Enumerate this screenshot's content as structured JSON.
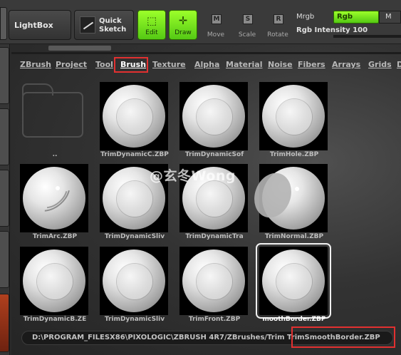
{
  "toolbar": {
    "lightbox_label": "LightBox",
    "quick_line1": "Quick",
    "quick_line2": "Sketch",
    "edit_label": "Edit",
    "draw_label": "Draw",
    "move_label": "Move",
    "move_key": "M",
    "scale_label": "Scale",
    "scale_key": "S",
    "rotate_label": "Rotate",
    "rotate_key": "R",
    "mrgb_label": "Mrgb",
    "rgb_label": "Rgb",
    "m_label": "M",
    "intensity_label": "Rgb  Intensity 100",
    "accent_color": "#7de81f"
  },
  "tabs": [
    "ZBrush",
    "Project",
    "Tool",
    "Brush",
    "Texture",
    "Alpha",
    "Material",
    "Noise",
    "Fibers",
    "Arrays",
    "Grids",
    "D"
  ],
  "active_tab": "Brush",
  "tiles": [
    {
      "label": "..",
      "kind": "folder"
    },
    {
      "label": "TrimDynamicC.ZBP",
      "kind": "sphere"
    },
    {
      "label": "TrimDynamicSof",
      "kind": "sphere"
    },
    {
      "label": "TrimHole.ZBP",
      "kind": "sphere"
    },
    {
      "label": "TrimArc.ZBP",
      "kind": "arc"
    },
    {
      "label": "TrimDynamicSliv",
      "kind": "sphere"
    },
    {
      "label": "TrimDynamicTra",
      "kind": "sphere"
    },
    {
      "label": "TrimNormal.ZBP",
      "kind": "normal"
    },
    {
      "label": "TrimDynamicB.ZE",
      "kind": "sphere"
    },
    {
      "label": "TrimDynamicSliv",
      "kind": "sphere"
    },
    {
      "label": "TrimFront.ZBP",
      "kind": "sphere"
    },
    {
      "label": "moothBorder.ZBP",
      "kind": "sphere",
      "selected": true
    }
  ],
  "watermark": "@玄冬Wong",
  "path_text": "D:\\PROGRAM_FILESX86\\PIXOLOGIC\\ZBRUSH 4R7/ZBrushes/Trim TrimSmoothBorder.ZBP",
  "highlight_color": "#e23030"
}
